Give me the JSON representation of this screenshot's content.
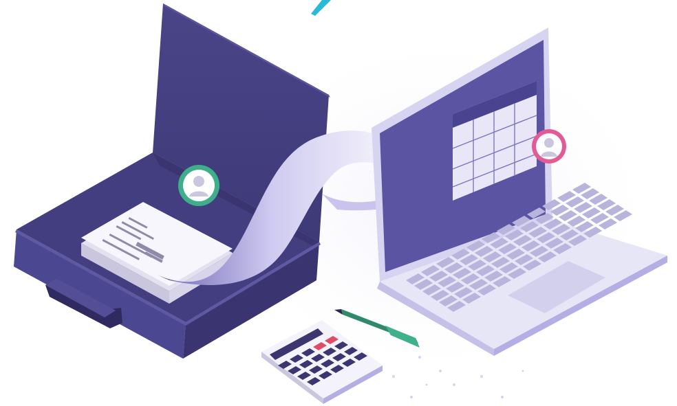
{
  "illustration": {
    "subject": "",
    "palette": {
      "background": "#ffffff",
      "case_dark": "#3b3670",
      "case_mid": "#4a4588",
      "case_light": "#5a559c",
      "paper": "#f1f0f8",
      "ribbon": "#cfcaf0",
      "laptop_body": "#e7e6f7",
      "laptop_edge": "#b9b5e6",
      "screen": "#5b54a3",
      "accent_teal": "#2bb9d9",
      "avatar_green": "#3fae8a",
      "avatar_pink": "#e25b97",
      "pen_green": "#2f8a6a",
      "calc_red": "#e04c66"
    },
    "icons": {
      "avatar_left": "user-avatar-icon",
      "avatar_right": "user-avatar-icon"
    }
  }
}
